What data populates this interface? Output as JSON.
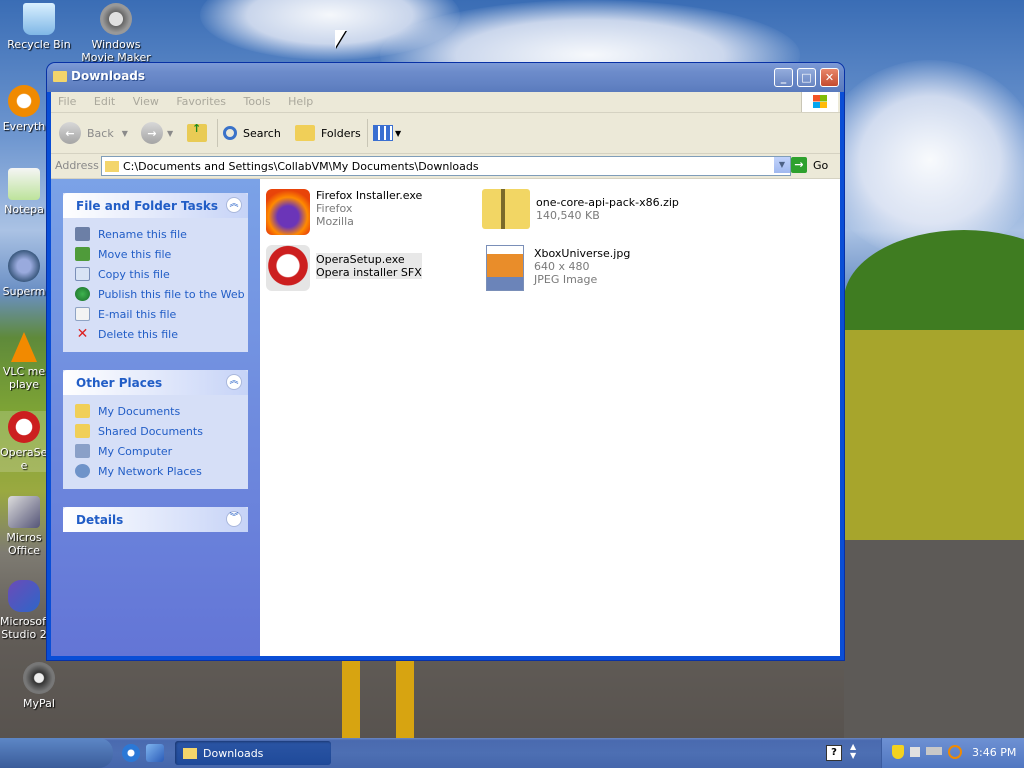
{
  "desktop": {
    "icons": [
      {
        "label": "Recycle Bin"
      },
      {
        "label": "Windows Movie Maker"
      },
      {
        "label": "Everyth"
      },
      {
        "label": "Notepa"
      },
      {
        "label": "Superm"
      },
      {
        "label": "VLC me playe"
      },
      {
        "label": "OperaSet e"
      },
      {
        "label": "Micros Office"
      },
      {
        "label": "Microsoft Studio 2"
      },
      {
        "label": "MyPal"
      }
    ]
  },
  "window": {
    "title": "Downloads",
    "menu": [
      "File",
      "Edit",
      "View",
      "Favorites",
      "Tools",
      "Help"
    ],
    "toolbar": {
      "back": "Back",
      "search": "Search",
      "folders": "Folders"
    },
    "address": {
      "label": "Address",
      "value": "C:\\Documents and Settings\\CollabVM\\My Documents\\Downloads",
      "go": "Go"
    },
    "tasks_panel": {
      "title": "File and Folder Tasks",
      "items": [
        "Rename this file",
        "Move this file",
        "Copy this file",
        "Publish this file to the Web",
        "E-mail this file",
        "Delete this file"
      ]
    },
    "places_panel": {
      "title": "Other Places",
      "items": [
        "My Documents",
        "Shared Documents",
        "My Computer",
        "My Network Places"
      ]
    },
    "details_panel": {
      "title": "Details"
    },
    "files": [
      {
        "name": "Firefox Installer.exe",
        "line2": "Firefox",
        "line3": "Mozilla",
        "icon": "firefox-icon"
      },
      {
        "name": "one-core-api-pack-x86.zip",
        "line2": "140,540 KB",
        "line3": "",
        "icon": "zip-folder-icon"
      },
      {
        "name": "OperaSetup.exe",
        "line2": "Opera installer SFX",
        "line3": "",
        "icon": "opera-icon"
      },
      {
        "name": "XboxUniverse.jpg",
        "line2": "640 x 480",
        "line3": "JPEG Image",
        "icon": "jpeg-image-icon"
      }
    ]
  },
  "taskbar": {
    "button": "Downloads",
    "clock": "3:46 PM"
  }
}
